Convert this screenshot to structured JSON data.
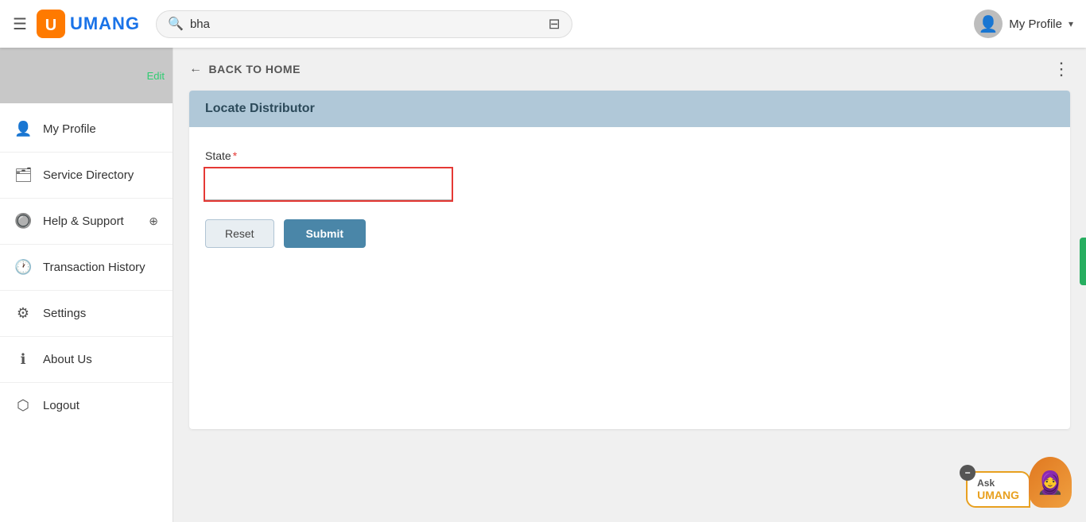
{
  "header": {
    "hamburger_label": "☰",
    "logo_text": "UMANG",
    "search_placeholder": "bha",
    "search_value": "bha",
    "filter_icon": "⊟",
    "profile_label": "My Profile",
    "profile_chevron": "▾"
  },
  "sidebar": {
    "edit_link": "Edit",
    "items": [
      {
        "id": "my-profile",
        "label": "My Profile",
        "icon": "👤",
        "expandable": false
      },
      {
        "id": "service-directory",
        "label": "Service Directory",
        "icon": "🗂",
        "expandable": false
      },
      {
        "id": "help-support",
        "label": "Help & Support",
        "icon": "🔘",
        "expandable": true
      },
      {
        "id": "transaction-history",
        "label": "Transaction History",
        "icon": "🕐",
        "expandable": false
      },
      {
        "id": "settings",
        "label": "Settings",
        "icon": "⚙",
        "expandable": false
      },
      {
        "id": "about-us",
        "label": "About Us",
        "icon": "ℹ",
        "expandable": false
      },
      {
        "id": "logout",
        "label": "Logout",
        "icon": "⬡",
        "expandable": false
      }
    ]
  },
  "back_bar": {
    "back_label": "BACK TO HOME",
    "more_icon": "⋮"
  },
  "form": {
    "title": "Locate Distributor",
    "state_label": "State",
    "state_required": "*",
    "state_placeholder": "",
    "reset_label": "Reset",
    "submit_label": "Submit"
  },
  "ask_umang": {
    "ask_label": "Ask",
    "umang_label": "UMANG",
    "close_icon": "−"
  }
}
